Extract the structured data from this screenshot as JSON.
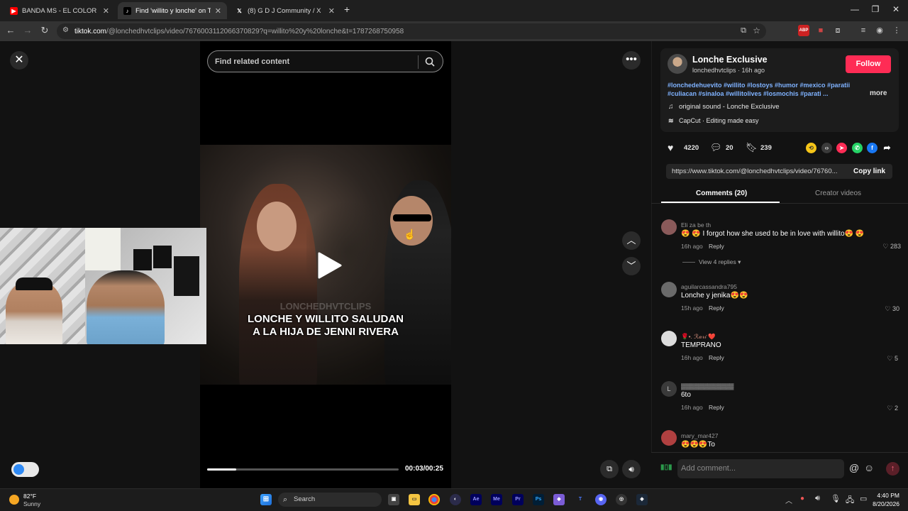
{
  "tabs": [
    {
      "title": "BANDA MS - EL COLOR DE TUS",
      "favicon": "youtube-icon",
      "color": "#ff0000"
    },
    {
      "title": "Find 'willito y lonche' on TikTok",
      "favicon": "tiktok-icon",
      "color": "#ffffff"
    },
    {
      "title": "(8) G D J Community / X",
      "favicon": "x-icon",
      "color": "#ffffff"
    }
  ],
  "address": {
    "host": "tiktok.com",
    "path": "/@lonchedhvtclips/video/7676003112066370829?q=willito%20y%20lonche&t=1787268750958"
  },
  "video": {
    "search_placeholder": "Find related content",
    "caption_line1": "LONCHE Y WILLITO SALUDAN",
    "caption_line2": "A LA HIJA DE JENNI RIVERA",
    "watermark": "LONCHEDHVTCLIPS",
    "time": "00:03/00:25",
    "progress_fraction": 0.15
  },
  "creator": {
    "name": "Lonche Exclusive",
    "handle": "lonchedhvtclips · 16h ago",
    "follow_label": "Follow",
    "hashtags_line1": "#lonchedehuevito #willito #lostoys #humor #mexico #paratii",
    "hashtags_line2": "#culiacan #sinaloa #willitolives #losmochis #parati ...",
    "more_label": "more",
    "sound": "original sound - Lonche Exclusive",
    "capcut": "CapCut · Editing made easy"
  },
  "actions": {
    "likes": "4220",
    "comments": "20",
    "saves": "239"
  },
  "link": {
    "url": "https://www.tiktok.com/@lonchedhvtclips/video/76760...",
    "copy_label": "Copy link"
  },
  "panel_tabs": {
    "comments": "Comments (20)",
    "creator_videos": "Creator videos"
  },
  "comments": [
    {
      "user": "Eli za be th",
      "text": "😍 😍 I forgot how she used to be in love with willito😍 😍",
      "time": "16h ago",
      "reply": "Reply",
      "likes": "283",
      "view_replies": "View 4 replies",
      "avatar_color": "#8a5a5a"
    },
    {
      "user": "aguilarcassandra795",
      "text": "Lonche y jenika😍😍",
      "time": "15h ago",
      "reply": "Reply",
      "likes": "30",
      "avatar_color": "#6a6a6a"
    },
    {
      "user": "🌹•. ℛ𝒶𝓇𝒾 ❤️",
      "text": "TEMPRANO",
      "time": "16h ago",
      "reply": "Reply",
      "likes": "5",
      "avatar_color": "#dddddd"
    },
    {
      "user": "▓▓▓▓▓▓▓▓▓▓▓▓",
      "text": "6to",
      "time": "16h ago",
      "reply": "Reply",
      "likes": "2",
      "avatar_color": "#3a3a3a",
      "avatar_letter": "L"
    },
    {
      "user": "mary_mar427",
      "text": "😍😍😍To",
      "avatar_color": "#b04040"
    }
  ],
  "comment_input": {
    "placeholder": "Add comment..."
  },
  "taskbar": {
    "temp": "82°F",
    "weather": "Sunny",
    "search": "Search",
    "time": "4:40 PM",
    "date": "8/20/2026"
  }
}
